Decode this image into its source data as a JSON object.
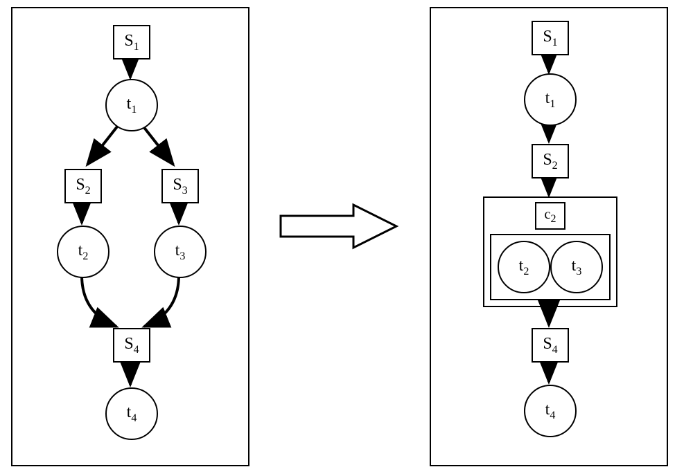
{
  "left": {
    "s1": "S",
    "s1_sub": "1",
    "t1": "t",
    "t1_sub": "1",
    "s2": "S",
    "s2_sub": "2",
    "s3": "S",
    "s3_sub": "3",
    "t2": "t",
    "t2_sub": "2",
    "t3": "t",
    "t3_sub": "3",
    "s4": "S",
    "s4_sub": "4",
    "t4": "t",
    "t4_sub": "4"
  },
  "right": {
    "s1": "S",
    "s1_sub": "1",
    "t1": "t",
    "t1_sub": "1",
    "s2": "S",
    "s2_sub": "2",
    "c2": "c",
    "c2_sub": "2",
    "t2": "t",
    "t2_sub": "2",
    "t3": "t",
    "t3_sub": "3",
    "s4": "S",
    "s4_sub": "4",
    "t4": "t",
    "t4_sub": "4"
  }
}
